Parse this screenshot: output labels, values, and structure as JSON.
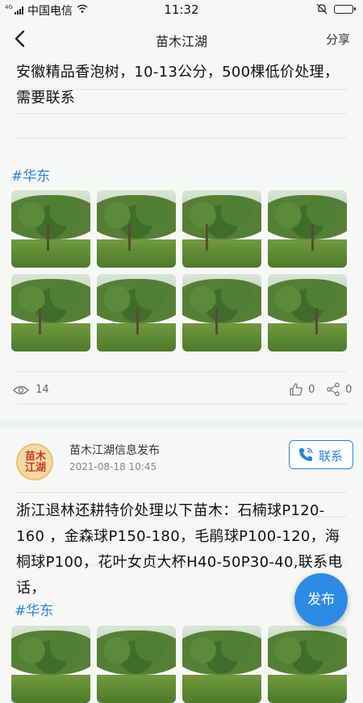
{
  "status_bar": {
    "network": "4G",
    "carrier": "中国电信",
    "time": "11:32"
  },
  "nav": {
    "title": "苗木江湖",
    "share_label": "分享"
  },
  "posts": [
    {
      "text": "安徽精品香泡树，10-13公分，500棵低价处理，需要联系",
      "tag": "#华东",
      "photo_count": 8,
      "views": "14",
      "likes": "0",
      "shares": "0"
    },
    {
      "author": "苗木江湖信息发布",
      "avatar_text": "苗木江湖",
      "date": "2021-08-18 10:45",
      "contact_label": "联系",
      "text": "浙江退林还耕特价处理以下苗木：石楠球P120-160 ，金森球P150-180，毛鹃球P100-120，海桐球P100，花叶女贞大杯H40-50P30-40,联系电话，",
      "tag": "#华东"
    }
  ],
  "fab_label": "发布",
  "colors": {
    "accent": "#2d82d8",
    "fab": "#2d8be6"
  },
  "icons": [
    "back-arrow-icon",
    "eye-icon",
    "thumb-up-icon",
    "share-icon",
    "phone-icon",
    "wifi-icon",
    "mute-bell-icon",
    "battery-icon"
  ]
}
